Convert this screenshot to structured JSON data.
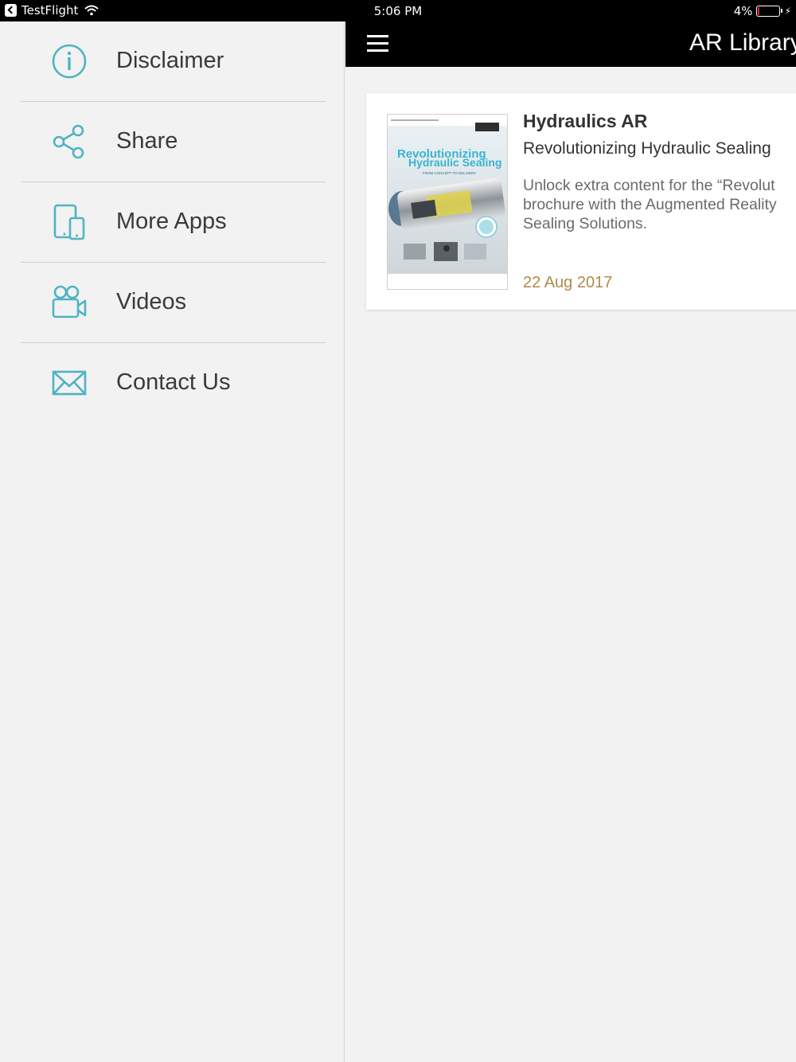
{
  "status_bar": {
    "app_name": "TestFlight",
    "time": "5:06 PM",
    "battery": "4%"
  },
  "side_menu": {
    "items": [
      {
        "label": "Disclaimer",
        "icon": "info-icon"
      },
      {
        "label": "Share",
        "icon": "share-icon"
      },
      {
        "label": "More Apps",
        "icon": "devices-icon"
      },
      {
        "label": "Videos",
        "icon": "video-camera-icon"
      },
      {
        "label": "Contact Us",
        "icon": "envelope-icon"
      }
    ]
  },
  "header": {
    "title": "AR Library",
    "menu_icon": "hamburger-icon"
  },
  "library": {
    "items": [
      {
        "title": "Hydraulics AR",
        "subtitle": "Revolutionizing Hydraulic Sealing",
        "description_lines": [
          "Unlock extra content for the “Revolut",
          "brochure with the Augmented Reality",
          "Sealing Solutions."
        ],
        "date": "22 Aug 2017",
        "thumbnail": {
          "heading_1": "Revolutionizing",
          "heading_2": "Hydraulic Sealing",
          "tagline": "FROM CONCEPT TO DELIVERY"
        }
      }
    ]
  },
  "colors": {
    "accent_teal": "#4fb3c3",
    "date_gold": "#b08a4a",
    "bar_black": "#000000"
  }
}
